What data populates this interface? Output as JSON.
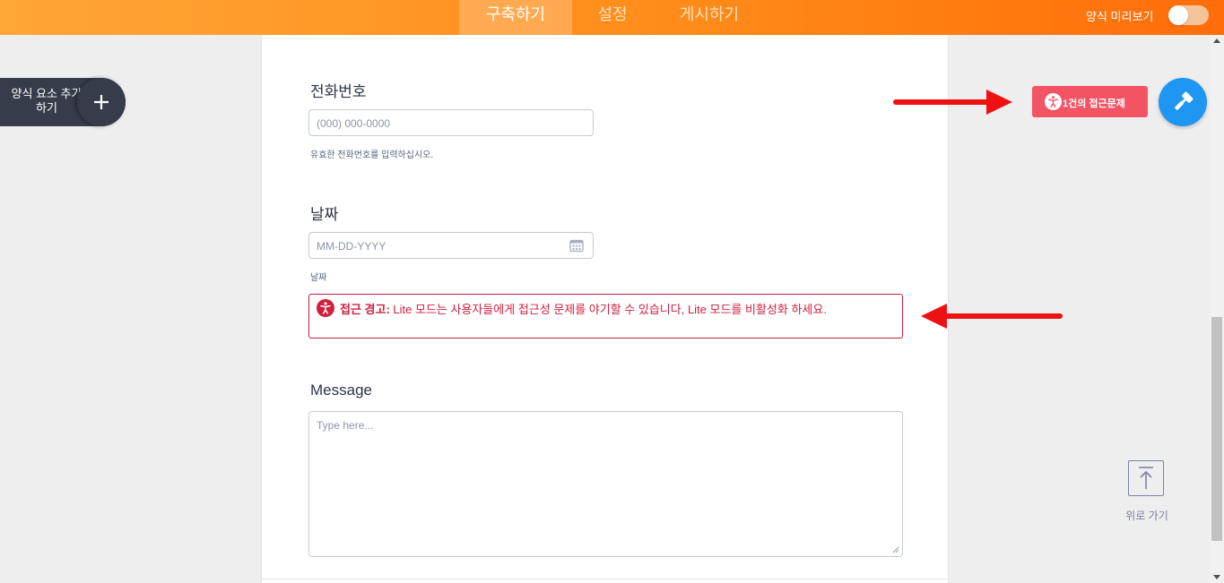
{
  "topbar": {
    "tabs": [
      {
        "label": "구축하기",
        "active": true
      },
      {
        "label": "설정",
        "active": false
      },
      {
        "label": "게시하기",
        "active": false
      }
    ],
    "preview_label": "양식 미리보기",
    "preview_enabled": false
  },
  "add_element": {
    "label": "양식 요소 추가하기"
  },
  "form": {
    "phone": {
      "label": "전화번호",
      "placeholder": "(000) 000-0000",
      "sublabel": "유효한 전화번호를 입력하십시오."
    },
    "date": {
      "label": "날짜",
      "placeholder": "MM-DD-YYYY",
      "sublabel": "날짜"
    },
    "alert": {
      "title": "접근 경고:",
      "message": " Lite 모드는 사용자들에게 접근성 문제를 야기할 수 있습니다, Lite 모드를 비활성화 하세요."
    },
    "message": {
      "label": "Message",
      "placeholder": "Type here..."
    }
  },
  "sidebar_right": {
    "accessibility_button": "1건의 접근문제",
    "scroll_top_label": "위로 가기"
  },
  "colors": {
    "topbar_start": "#ffa636",
    "topbar_end": "#ff6d0a",
    "alert_red": "#d01e3f",
    "access_button": "#f35464",
    "designer_blue": "#1e96f2",
    "arrow_red": "#ee1111"
  },
  "icons": {
    "accessibility": "accessibility-person-icon",
    "calendar": "calendar-icon",
    "plus": "plus-icon",
    "designer": "paint-roller-icon",
    "scroll_top": "arrow-up-icon"
  }
}
